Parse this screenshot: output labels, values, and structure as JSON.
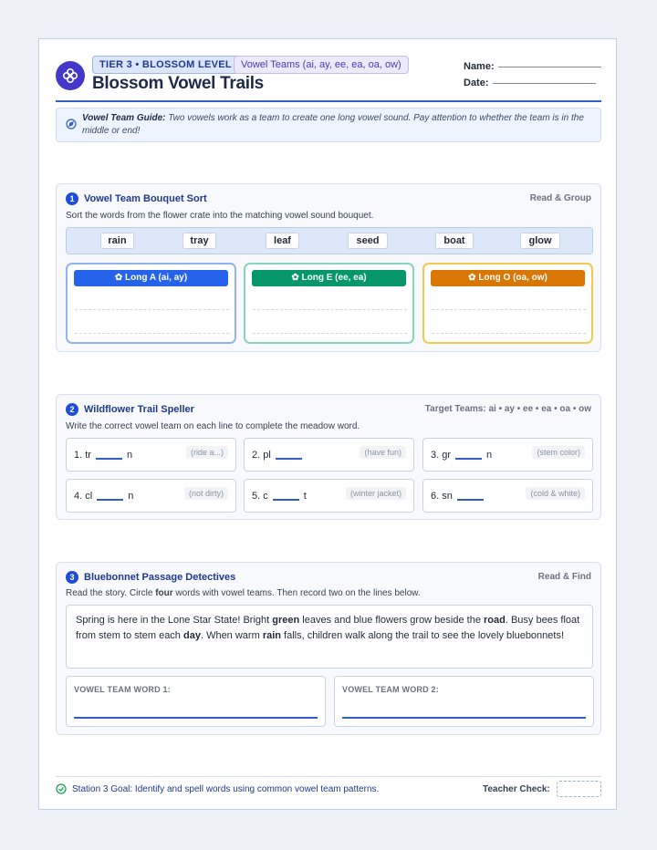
{
  "header": {
    "tier_tag": "TIER 3 • BLOSSOM LEVEL",
    "teams_tag": "Vowel Teams (ai, ay, ee, ea, oa, ow)",
    "title": "Blossom Vowel Trails",
    "name_label": "Name:",
    "date_label": "Date:"
  },
  "guide": {
    "label": "Vowel Team Guide:",
    "text": " Two vowels work as a team to create one long vowel sound. Pay attention to whether the team is in the middle or end!"
  },
  "section1": {
    "number": "1",
    "title": "Vowel Team Bouquet Sort",
    "right": "Read & Group",
    "instruction": "Sort the words from the flower crate into the matching vowel sound bouquet.",
    "words": [
      "rain",
      "tray",
      "leaf",
      "seed",
      "boat",
      "glow"
    ],
    "bouquets": [
      {
        "label": "Long A (ai, ay)",
        "color": "#2563eb",
        "border": "#8fb4ef"
      },
      {
        "label": "Long E (ee, ea)",
        "color": "#059669",
        "border": "#86d6bd"
      },
      {
        "label": "Long O (oa, ow)",
        "color": "#d97706",
        "border": "#f2c94c"
      }
    ]
  },
  "section2": {
    "number": "2",
    "title": "Wildflower Trail Speller",
    "right": "Target Teams: ai • ay • ee • ea • oa • ow",
    "instruction": "Write the correct vowel team on each line to complete the meadow word.",
    "items": [
      {
        "pre": "1. tr",
        "post": "n",
        "hint": "(ride a...)"
      },
      {
        "pre": "2. pl",
        "post": "",
        "hint": "(have fun)"
      },
      {
        "pre": "3. gr",
        "post": "n",
        "hint": "(stem color)"
      },
      {
        "pre": "4. cl",
        "post": "n",
        "hint": "(not dirty)"
      },
      {
        "pre": "5. c",
        "post": "t",
        "hint": "(winter jacket)"
      },
      {
        "pre": "6. sn",
        "post": "",
        "hint": "(cold & white)"
      }
    ]
  },
  "section3": {
    "number": "3",
    "title": "Bluebonnet Passage Detectives",
    "right": "Read & Find",
    "instruction_pre": "Read the story. Circle ",
    "instruction_bold": "four",
    "instruction_post": " words with vowel teams. Then record two on the lines below.",
    "passage": [
      {
        "t": "Spring is here in the Lone Star State! Bright ",
        "b": false
      },
      {
        "t": "green",
        "b": true
      },
      {
        "t": " leaves and blue flowers grow beside the ",
        "b": false
      },
      {
        "t": "road",
        "b": true
      },
      {
        "t": ". Busy bees float from stem to stem each ",
        "b": false
      },
      {
        "t": "day",
        "b": true
      },
      {
        "t": ". When warm ",
        "b": false
      },
      {
        "t": "rain",
        "b": true
      },
      {
        "t": " falls, children walk along the trail to see the lovely bluebonnets!",
        "b": false
      }
    ],
    "record1": "VOWEL TEAM WORD 1:",
    "record2": "VOWEL TEAM WORD 2:"
  },
  "footer": {
    "goal": "Station 3 Goal: Identify and spell words using common vowel team patterns.",
    "teacher_check": "Teacher Check:"
  }
}
